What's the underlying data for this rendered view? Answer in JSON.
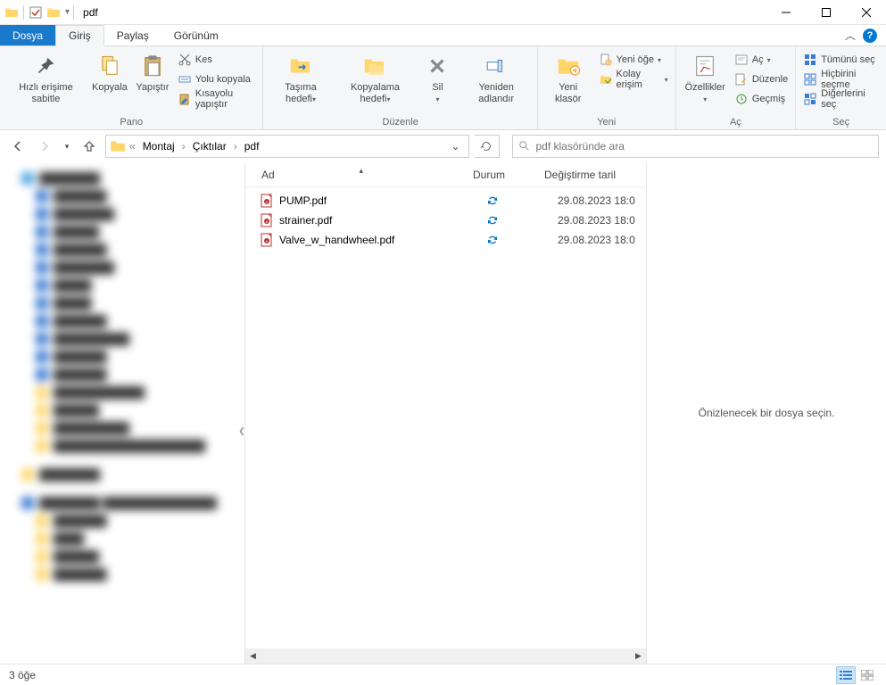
{
  "window": {
    "title": "pdf"
  },
  "tabs": {
    "file": "Dosya",
    "home": "Giriş",
    "share": "Paylaş",
    "view": "Görünüm"
  },
  "ribbon": {
    "pin": "Hızlı erişime sabitle",
    "copy": "Kopyala",
    "paste": "Yapıştır",
    "cut": "Kes",
    "copy_path": "Yolu kopyala",
    "paste_shortcut": "Kısayolu yapıştır",
    "group_clipboard": "Pano",
    "move_to": "Taşıma hedefi",
    "copy_to": "Kopyalama hedefi",
    "delete": "Sil",
    "rename": "Yeniden adlandır",
    "group_organize": "Düzenle",
    "new_folder": "Yeni klasör",
    "new_item": "Yeni öğe",
    "easy_access": "Kolay erişim",
    "group_new": "Yeni",
    "properties": "Özellikler",
    "open": "Aç",
    "edit": "Düzenle",
    "history": "Geçmiş",
    "group_open": "Aç",
    "select_all": "Tümünü seç",
    "select_none": "Hiçbirini seçme",
    "invert_selection": "Diğerlerini seç",
    "group_select": "Seç"
  },
  "breadcrumbs": [
    "Montaj",
    "Çıktılar",
    "pdf"
  ],
  "search": {
    "placeholder": "pdf klasöründe ara"
  },
  "columns": {
    "name": "Ad",
    "status": "Durum",
    "date": "Değiştirme taril"
  },
  "files": [
    {
      "name": "PUMP.pdf",
      "date": "29.08.2023 18:0"
    },
    {
      "name": "strainer.pdf",
      "date": "29.08.2023 18:0"
    },
    {
      "name": "Valve_w_handwheel.pdf",
      "date": "29.08.2023 18:0"
    }
  ],
  "preview": {
    "empty": "Önizlenecek bir dosya seçin."
  },
  "status": {
    "count": "3 öğe"
  }
}
